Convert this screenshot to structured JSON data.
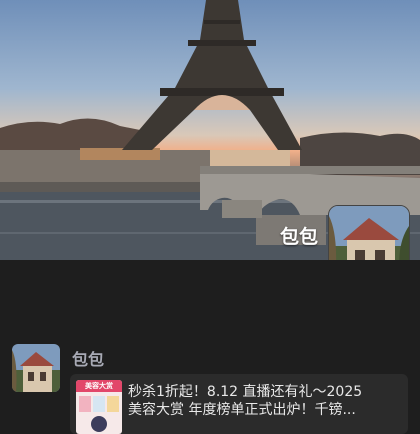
{
  "banner": {
    "title": "包包",
    "image": "eiffel-tower-seine-bridge-photo",
    "thumbnail": "european-house-photo"
  },
  "post": {
    "author": "包包",
    "thumbnail": "european-house-photo",
    "promo": {
      "image_label": "美容大赏",
      "line1": "秒杀1折起！8.12 直播还有礼～2025",
      "line2": "美容大赏 年度榜单正式出炉！千镑..."
    }
  }
}
